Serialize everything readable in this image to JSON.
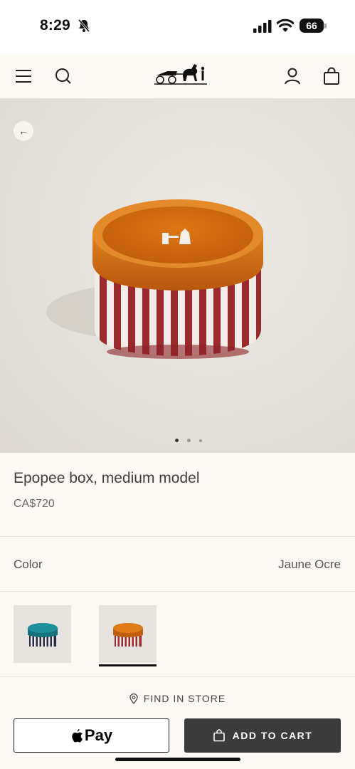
{
  "status_bar": {
    "time": "8:29",
    "battery": "66"
  },
  "header": {
    "logo": "horse-carriage-logo"
  },
  "product": {
    "title": "Epopee box, medium model",
    "price": "CA$720",
    "image_count": 3,
    "image_index": 1
  },
  "color": {
    "label": "Color",
    "value": "Jaune Ocre"
  },
  "swatches": [
    {
      "name": "teal-lid",
      "lid_color": "#1a7f8a"
    },
    {
      "name": "orange-lid",
      "lid_color": "#d66a12",
      "selected": true
    }
  ],
  "actions": {
    "find_in_store": "FIND IN STORE",
    "apple_pay": "Pay",
    "add_to_cart": "ADD TO CART"
  },
  "colors": {
    "accent_orange": "#d66a12",
    "stripe_red": "#9a2a2e",
    "cart_bg": "#3b3b3b"
  }
}
